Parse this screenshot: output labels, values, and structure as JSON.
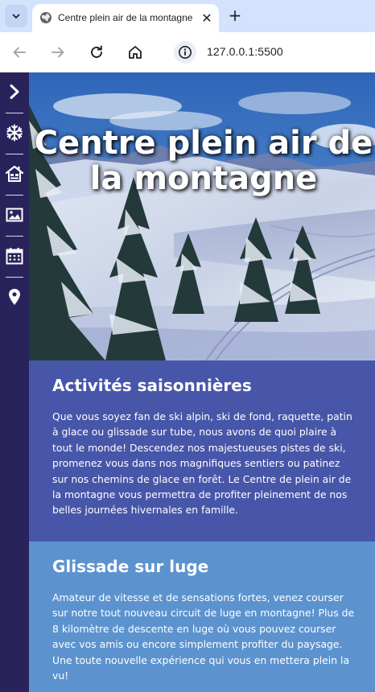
{
  "browser": {
    "tab_title": "Centre plein air de la montagne",
    "close_glyph": "✕",
    "new_tab_glyph": "+",
    "url": "127.0.0.1:5500"
  },
  "sidebar": {
    "items": [
      {
        "icon": "chevron-right-icon"
      },
      {
        "icon": "snowflake-icon"
      },
      {
        "icon": "lodge-icon"
      },
      {
        "icon": "image-icon"
      },
      {
        "icon": "calendar-icon"
      },
      {
        "icon": "location-pin-icon"
      }
    ]
  },
  "hero": {
    "title": "Centre plein air de la montagne"
  },
  "sections": [
    {
      "title": "Activités saisonnières",
      "text": "Que vous soyez fan de ski alpin, ski de fond, raquette, patin à glace ou glissade sur tube, nous avons de quoi plaire à tout le monde! Descendez nos majestueuses pistes de ski, promenez vous dans nos magnifiques sentiers ou patinez sur nos chemins de glace en forêt. Le Centre de plein air de la montagne vous permettra de profiter pleinement de nos belles journées hivernales en famille."
    },
    {
      "title": "Glissade sur luge",
      "text": "Amateur de vitesse et de sensations fortes, venez courser sur notre tout nouveau circuit de luge en montagne! Plus de 8 kilomètre de descente en luge où vous pouvez courser avec vos amis ou encore simplement profiter du paysage. Une toute nouvelle expérience qui vous en mettera plein la vu!"
    }
  ],
  "colors": {
    "sidebar": "#29235c",
    "section_1": "#4756a8",
    "section_2": "#5c93cf",
    "tabstrip": "#d3e3fd"
  }
}
